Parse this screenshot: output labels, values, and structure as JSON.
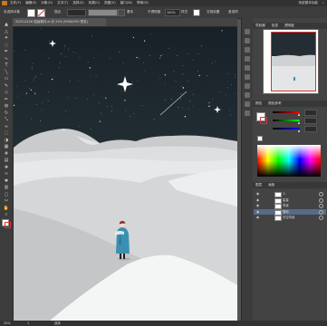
{
  "menubar": {
    "items": [
      "文件(F)",
      "编辑(E)",
      "对象(O)",
      "文字(T)",
      "选择(S)",
      "效果(C)",
      "视图(V)",
      "窗口(W)",
      "帮助(H)"
    ],
    "right_items": [
      "传统基本功能",
      "搜索"
    ]
  },
  "controlbar": {
    "selection_label": "未选择对象",
    "stroke_label": "描边",
    "style_label": "样式",
    "mode_label": "基本",
    "opacity_label": "不透明度",
    "opacity_value": "100%",
    "doc_setup": "文档设置",
    "preferences": "首选项"
  },
  "document": {
    "tab_title": "2025-0426 插画素材.ai @ 25% (RGB/GPU 预览)"
  },
  "statusbar": {
    "zoom": "25%",
    "artboard": "1",
    "tool": "选择"
  },
  "panels": {
    "navigator_tabs": [
      "导航器",
      "信息",
      "透明度"
    ],
    "color_tabs": [
      "颜色",
      "颜色参考"
    ],
    "layers_tabs": [
      "图层",
      "画板"
    ]
  },
  "layers": [
    {
      "name": "人",
      "selected": false
    },
    {
      "name": "星星",
      "selected": false
    },
    {
      "name": "背景",
      "selected": false
    },
    {
      "name": "雪地",
      "selected": true
    },
    {
      "name": "天空背景",
      "selected": false
    }
  ],
  "colors": {
    "sky_top": "#1a2329",
    "sky_bottom": "#2e3a40",
    "snow": "#e8eaeb",
    "person_coat": "#3b8fb2",
    "selection_red": "#e03030",
    "layer_highlight": "#566b87"
  },
  "tool_icons": [
    "selection-tool",
    "direct-selection-tool",
    "magic-wand-tool",
    "lasso-tool",
    "pen-tool",
    "curvature-tool",
    "type-tool",
    "line-tool",
    "rectangle-tool",
    "paintbrush-tool",
    "shaper-tool",
    "pencil-tool",
    "eraser-tool",
    "rotate-tool",
    "scale-tool",
    "width-tool",
    "free-transform-tool",
    "shape-builder-tool",
    "perspective-tool",
    "mesh-tool",
    "gradient-tool",
    "eyedropper-tool",
    "blend-tool",
    "symbol-sprayer-tool",
    "column-graph-tool",
    "artboard-tool",
    "slice-tool",
    "hand-tool",
    "zoom-tool"
  ]
}
